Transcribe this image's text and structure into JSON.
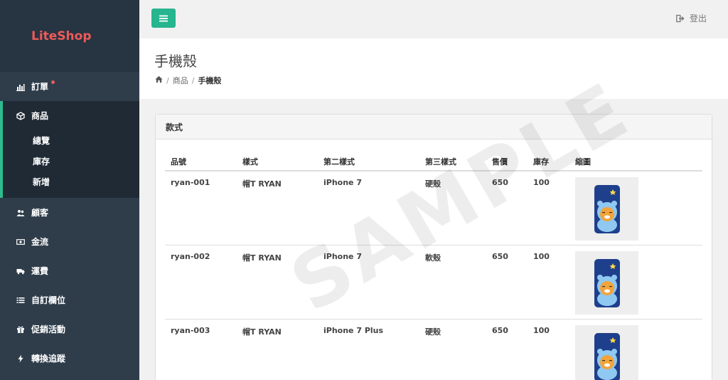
{
  "brand": "LiteShop",
  "nav": {
    "orders": "訂單",
    "products": "商品",
    "product_sub": [
      "總覽",
      "庫存",
      "新增"
    ],
    "customers": "顧客",
    "cashflow": "金流",
    "shipping": "運費",
    "custom_fields": "自訂欄位",
    "promotions": "促銷活動",
    "conversion": "轉換追蹤"
  },
  "topbar": {
    "logout_label": "登出"
  },
  "page": {
    "title": "手機殼",
    "breadcrumb": {
      "level1": "商品",
      "current": "手機殼"
    }
  },
  "panel": {
    "heading": "款式",
    "columns": [
      "品號",
      "樣式",
      "第二樣式",
      "第三樣式",
      "售價",
      "庫存",
      "縮圖"
    ],
    "rows": [
      {
        "sku": "ryan-001",
        "style": "帽T RYAN",
        "style2": "iPhone 7",
        "style3": "硬殼",
        "price": "650",
        "stock": "100"
      },
      {
        "sku": "ryan-002",
        "style": "帽T RYAN",
        "style2": "iPhone 7",
        "style3": "軟殼",
        "price": "650",
        "stock": "100"
      },
      {
        "sku": "ryan-003",
        "style": "帽T RYAN",
        "style2": "iPhone 7 Plus",
        "style3": "硬殼",
        "price": "650",
        "stock": "100"
      }
    ]
  },
  "watermark": "SAMPLE",
  "colors": {
    "accent": "#26b58e",
    "brand": "#ee5a5a",
    "sidebar": "#2f3d4b"
  }
}
